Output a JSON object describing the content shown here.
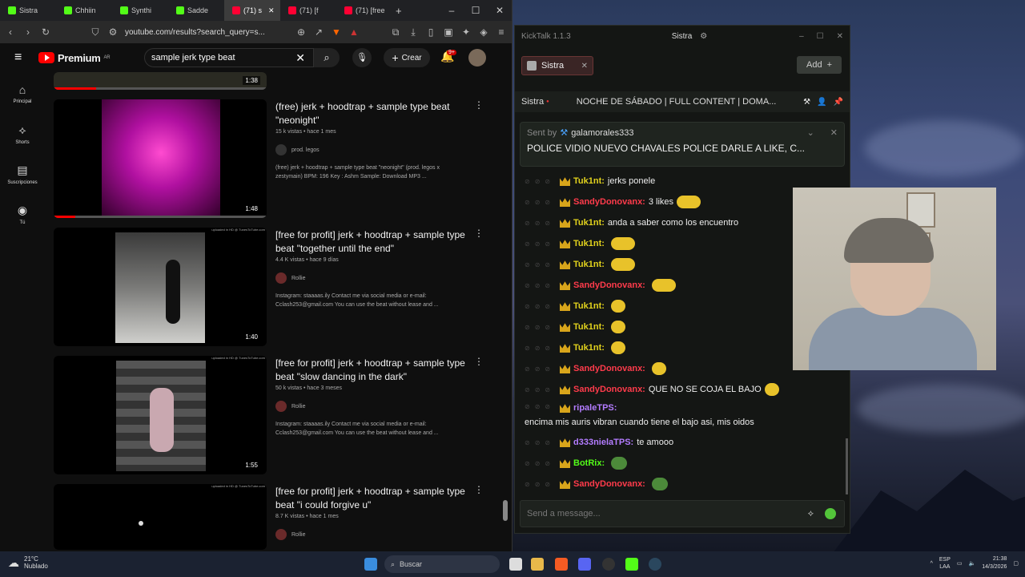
{
  "browser": {
    "tabs": [
      {
        "label": "Sistra",
        "color": "#53fc18"
      },
      {
        "label": "Chhiin",
        "color": "#53fc18"
      },
      {
        "label": "Synthi",
        "color": "#53fc18"
      },
      {
        "label": "Sadde",
        "color": "#53fc18"
      },
      {
        "label": "(71) s",
        "color": "#ff0033"
      },
      {
        "label": "(71) [f",
        "color": "#ff0033"
      },
      {
        "label": "(71) [free",
        "color": "#ff0033"
      }
    ],
    "url": "youtube.com/results?search_query=s...",
    "new_tab": "+"
  },
  "youtube": {
    "logo_text": "Premium",
    "logo_region": "AR",
    "search_value": "sample jerk type beat",
    "create_label": "Crear",
    "notif_badge": "9+",
    "nav": [
      "Principal",
      "Shorts",
      "Suscripciones",
      "Tú"
    ],
    "top_duration": "1:38",
    "results": [
      {
        "title": "(free) jerk + hoodtrap + sample type beat \"neonight\"",
        "meta": "15 k vistas • hace 1 mes",
        "channel": "prod. legos",
        "desc": "(free) jerk + hoodtrap + sample type beat \"neonight\" (prod. legos x zestymain) BPM: 196 Key : Ashm Sample: Download MP3 ...",
        "duration": "1:48",
        "progress": 0.1
      },
      {
        "title": "[free for profit] jerk + hoodtrap + sample type beat \"together until the end\"",
        "meta": "4.4 K vistas • hace 9 días",
        "channel": "Rollie",
        "desc": "Instagram: staaaas.ily Contact me via social media or e-mail: Cclash253@gmail.com You can use the beat without lease and ...",
        "duration": "1:40",
        "watermark": "uploaded in HD @ TunesToTube.com"
      },
      {
        "title": "[free for profit] jerk + hoodtrap + sample type beat \"slow dancing in the dark\"",
        "meta": "50 k vistas • hace 3 meses",
        "channel": "Rollie",
        "desc": "Instagram: staaaas.ily Contact me via social media or e-mail: Cclash253@gmail.com You can use the beat without lease and ...",
        "duration": "1:55",
        "watermark": "uploaded in HD @ TunesToTube.com"
      },
      {
        "title": "[free for profit] jerk + hoodtrap + sample type beat \"i could forgive u\"",
        "meta": "8.7 K vistas • hace 1 mes",
        "channel": "Rollie",
        "watermark": "uploaded in HD @ TunesToTube.com"
      }
    ]
  },
  "kicktalk": {
    "title": "KickTalk 1.1.3",
    "channel_name": "Sistra",
    "tab_label": "Sistra",
    "add_label": "Add",
    "stream_title": "NOCHE DE SÁBADO | FULL CONTENT | DOMA...",
    "pinned": {
      "sent_by": "Sent by",
      "user": "galamorales333",
      "message": "POLICE VIDIO NUEVO CHAVALES POLICE DARLE A LIKE, C..."
    },
    "messages": [
      {
        "user": "Tuk1nt:",
        "color": "#e2d21d",
        "text": "jerks ponele"
      },
      {
        "user": "SandyDonovanx:",
        "color": "#ff3b4b",
        "text": "3 likes",
        "emote": "wide"
      },
      {
        "user": "Tuk1nt:",
        "color": "#e2d21d",
        "text": "anda a saber como los encuentro"
      },
      {
        "user": "Tuk1nt:",
        "color": "#e2d21d",
        "text": "",
        "emote": "wide"
      },
      {
        "user": "Tuk1nt:",
        "color": "#e2d21d",
        "text": "",
        "emote": "wide"
      },
      {
        "user": "SandyDonovanx:",
        "color": "#ff3b4b",
        "text": "",
        "emote": "wide"
      },
      {
        "user": "Tuk1nt:",
        "color": "#e2d21d",
        "text": "",
        "emote": "small"
      },
      {
        "user": "Tuk1nt:",
        "color": "#e2d21d",
        "text": "",
        "emote": "small"
      },
      {
        "user": "Tuk1nt:",
        "color": "#e2d21d",
        "text": "",
        "emote": "small"
      },
      {
        "user": "SandyDonovanx:",
        "color": "#ff3b4b",
        "text": "",
        "emote": "small"
      },
      {
        "user": "SandyDonovanx:",
        "color": "#ff3b4b",
        "text": "QUE NO SE COJA EL BAJO",
        "emote": "small"
      },
      {
        "user": "ripaleTPS:",
        "color": "#b37cff",
        "text": "encima mis auris vibran cuando tiene el bajo asi, mis oidos"
      },
      {
        "user": "d333nielaTPS:",
        "color": "#b37cff",
        "text": "te amooo"
      },
      {
        "user": "BotRix:",
        "color": "#53fc18",
        "text": "",
        "emote": "green"
      },
      {
        "user": "SandyDonovanx:",
        "color": "#ff3b4b",
        "text": "",
        "emote": "green"
      }
    ],
    "input_placeholder": "Send a message..."
  },
  "taskbar": {
    "temp": "21°C",
    "weather": "Nublado",
    "search_placeholder": "Buscar",
    "lang": "ESP",
    "layout": "LAA",
    "time": "21:38",
    "date": "14/3/2026"
  }
}
